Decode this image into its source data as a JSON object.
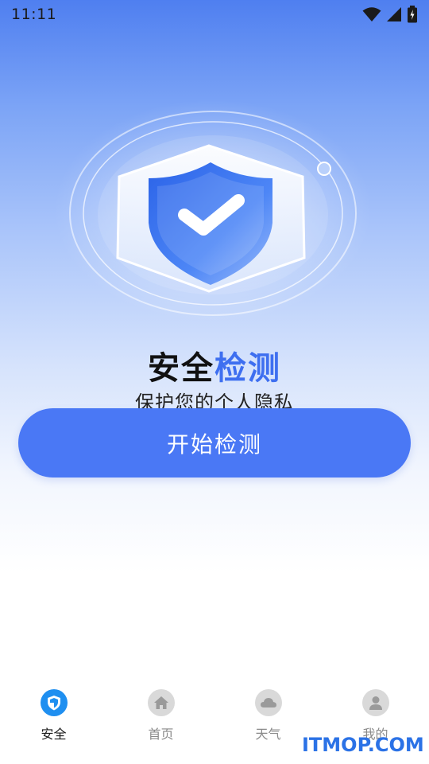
{
  "status_bar": {
    "time": "11:11"
  },
  "hero": {
    "title_part1": "安全",
    "title_part2": "检测",
    "subtitle": "保护您的个人隐私"
  },
  "actions": {
    "start_label": "开始检测"
  },
  "tabs": [
    {
      "label": "安全",
      "icon": "shield-icon",
      "active": true
    },
    {
      "label": "首页",
      "icon": "home-icon",
      "active": false
    },
    {
      "label": "天气",
      "icon": "cloud-icon",
      "active": false
    },
    {
      "label": "我的",
      "icon": "user-icon",
      "active": false
    }
  ],
  "watermark": "ITMOP.COM",
  "colors": {
    "accent": "#4a78f5",
    "title_highlight": "#3e6ff0",
    "active_tab": "#1f8ff0"
  }
}
